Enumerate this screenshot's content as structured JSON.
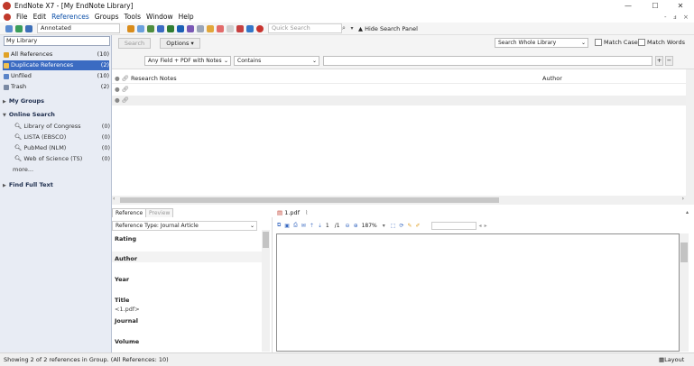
{
  "window": {
    "title": "EndNote X7 - [My EndNote Library]",
    "controls": [
      "—",
      "☐",
      "✕"
    ],
    "mdi_controls": [
      "-",
      "ⅎ",
      "×"
    ]
  },
  "menu": [
    "File",
    "Edit",
    "References",
    "Groups",
    "Tools",
    "Window",
    "Help"
  ],
  "menu_active": "References",
  "toolbar": {
    "style": "Annotated",
    "quick_search_placeholder": "Quick Search",
    "hide_search_panel": "Hide Search Panel"
  },
  "sidebar": {
    "library_field": "My Library",
    "groups": [
      {
        "label": "All References",
        "count": "(10)",
        "color": "#e0a126"
      },
      {
        "label": "Duplicate References",
        "count": "(2)",
        "color": "#e0a126",
        "selected": true
      },
      {
        "label": "Unfiled",
        "count": "(10)",
        "color": "#5a84c8"
      },
      {
        "label": "Trash",
        "count": "(2)",
        "color": "#7b8aa3"
      }
    ],
    "my_groups": "My Groups",
    "online_search": "Online Search",
    "online_items": [
      {
        "label": "Library of Congress",
        "count": "(0)"
      },
      {
        "label": "LISTA (EBSCO)",
        "count": "(0)"
      },
      {
        "label": "PubMed (NLM)",
        "count": "(0)"
      },
      {
        "label": "Web of Science (TS)",
        "count": "(0)"
      }
    ],
    "more": "more...",
    "find_full_text": "Find Full Text"
  },
  "search": {
    "search_button": "Search",
    "options_button": "Options",
    "scope": "Search Whole Library",
    "match_case": "Match Case",
    "match_words": "Match Words",
    "field": "Any Field + PDF with Notes",
    "operator": "Contains",
    "value": ""
  },
  "reference_list": {
    "columns": [
      "Research Notes",
      "Author"
    ],
    "rows": 2
  },
  "bottom": {
    "tabs": [
      "Reference",
      "Preview"
    ],
    "reference_type_label": "Reference Type:",
    "reference_type": "Journal Article",
    "fields": [
      {
        "label": "Rating",
        "value": ""
      },
      {
        "label": "Author",
        "value": ""
      },
      {
        "label": "Year",
        "value": ""
      },
      {
        "label": "Title",
        "value": "<1.pdf>"
      },
      {
        "label": "Journal",
        "value": ""
      },
      {
        "label": "Volume",
        "value": ""
      }
    ],
    "pdf_tab": "1.pdf",
    "zoom": "187%",
    "page_current": "1",
    "page_total": "/1"
  },
  "status": {
    "text": "Showing 2 of 2 references in Group. (All References: 10)",
    "layout": "Layout"
  }
}
